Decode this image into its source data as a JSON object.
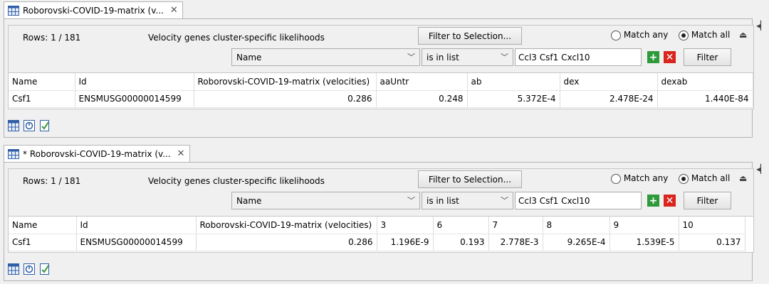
{
  "panels": [
    {
      "tab_title": "Roborovski-COVID-19-matrix (v...",
      "rows_label": "Rows: 1 / 181",
      "description": "Velocity genes cluster-specific likelihoods",
      "filter_to_selection": "Filter to Selection...",
      "match_any": "Match any",
      "match_all": "Match all",
      "column_combo": "Name",
      "operator_combo": "is in list",
      "filter_value": "Ccl3 Csf1 Cxcl10",
      "filter_button": "Filter",
      "headers": [
        "Name",
        "Id",
        "Roborovski-COVID-19-matrix (velocities)",
        "aaUntr",
        "ab",
        "dex",
        "dexab"
      ],
      "row": [
        "Csf1",
        "ENSMUSG00000014599",
        "0.286",
        "0.248",
        "5.372E-4",
        "2.478E-24",
        "1.440E-84"
      ]
    },
    {
      "tab_title": "* Roborovski-COVID-19-matrix (v...",
      "rows_label": "Rows: 1 / 181",
      "description": "Velocity genes cluster-specific likelihoods",
      "filter_to_selection": "Filter to Selection...",
      "match_any": "Match any",
      "match_all": "Match all",
      "column_combo": "Name",
      "operator_combo": "is in list",
      "filter_value": "Ccl3 Csf1 Cxcl10",
      "filter_button": "Filter",
      "headers": [
        "Name",
        "Id",
        "Roborovski-COVID-19-matrix (velocities)",
        "3",
        "6",
        "7",
        "8",
        "9",
        "10"
      ],
      "row": [
        "Csf1",
        "ENSMUSG00000014599",
        "0.286",
        "1.196E-9",
        "0.193",
        "2.778E-3",
        "9.265E-4",
        "1.539E-5",
        "0.137"
      ]
    }
  ],
  "colors": {
    "add": "#2e9a3a",
    "remove": "#d9251c",
    "border": "#b4b4b4"
  },
  "icons": [
    "table-icon",
    "close-icon",
    "chevron-down-icon",
    "plus-icon",
    "remove-icon",
    "eject-icon",
    "collapse-icon",
    "table-view-icon",
    "chart-view-icon",
    "checklist-icon"
  ]
}
